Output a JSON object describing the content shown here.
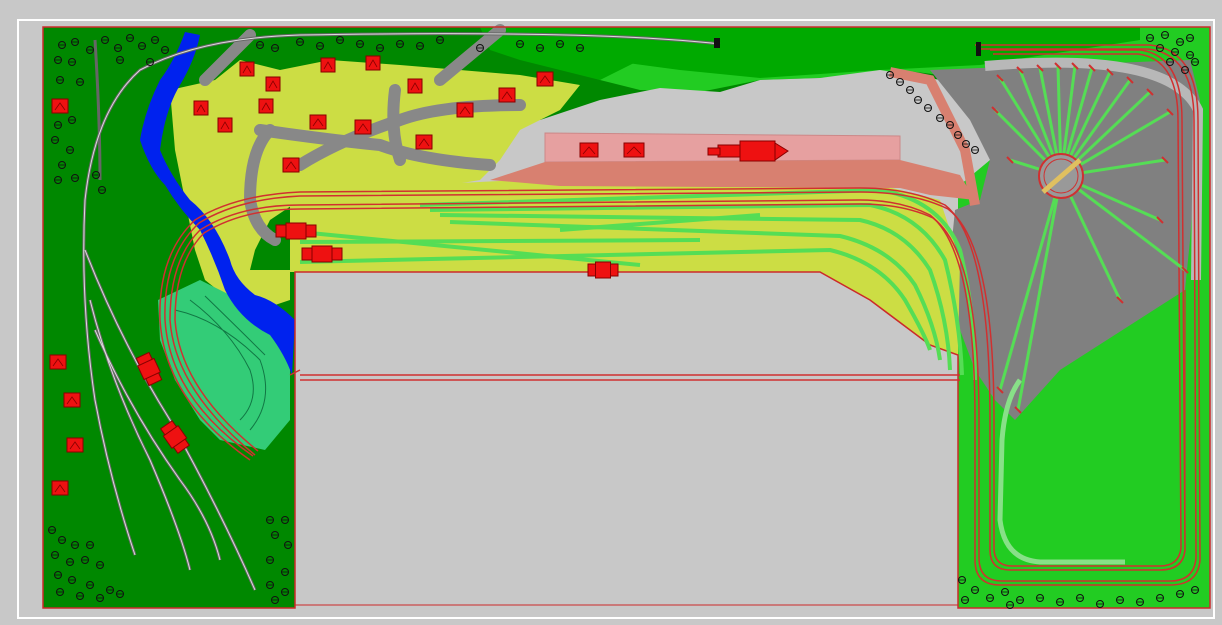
{
  "diagram": {
    "kind": "model-railway-track-plan",
    "colors": {
      "workspace": "#c8c8c8",
      "canvas_border": "#ffffff",
      "board_outline": "#cc2a2a",
      "grass_dark": "#008800",
      "grass_mid": "#00aa00",
      "grass_light": "#22cc22",
      "meadow_yellow": "#ccdd44",
      "meadow_pale": "#e0e870",
      "water": "#0022ee",
      "terrace_green": "#33cc77",
      "road": "#888888",
      "plaza": "#999999",
      "yard_floor": "#808080",
      "platform": "#e6a0a0",
      "platform_edge": "#d88070",
      "track_red": "#d03030",
      "track_green": "#55dd55",
      "track_gray": "#666666",
      "building": "#ee1111",
      "building_edge": "#880000",
      "tree": "#111111",
      "mountain": "#c8c8c8"
    },
    "icons": [
      "tree-icon",
      "house-icon",
      "turntable-icon",
      "loco-icon",
      "bumper-icon"
    ]
  }
}
